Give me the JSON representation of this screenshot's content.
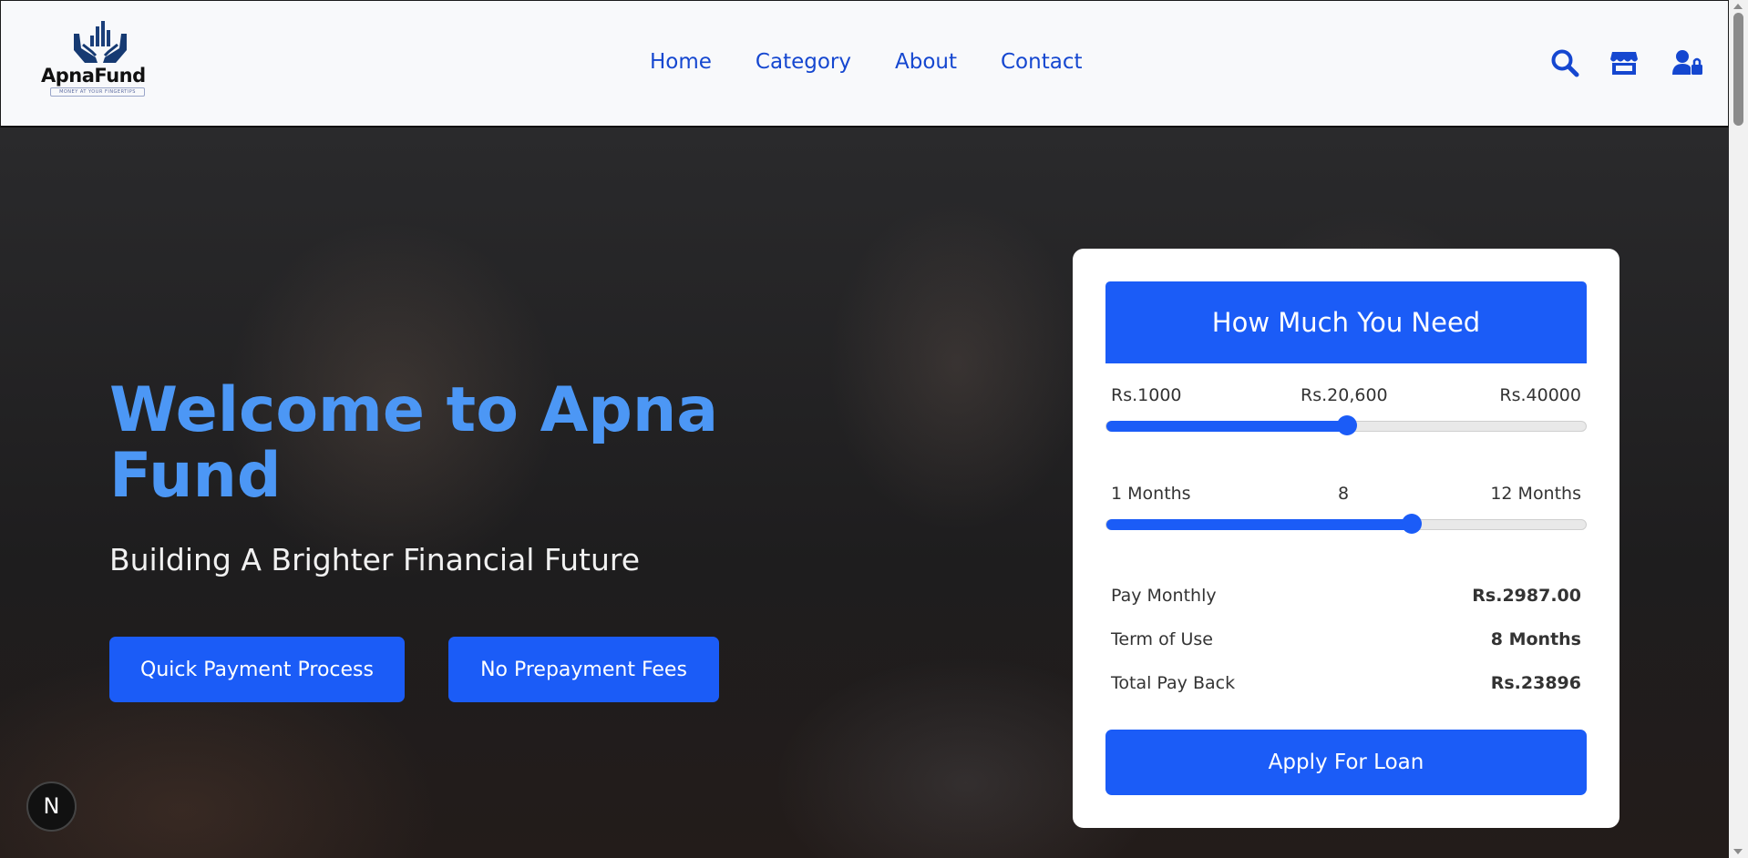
{
  "brand": {
    "name": "ApnaFund",
    "tagline": "MONEY AT YOUR FINGERTIPS",
    "icon": "hands-holding-coins-logo"
  },
  "nav": [
    {
      "label": "Home"
    },
    {
      "label": "Category"
    },
    {
      "label": "About"
    },
    {
      "label": "Contact"
    }
  ],
  "header_icons": [
    "search-icon",
    "store-icon",
    "user-lock-icon"
  ],
  "hero": {
    "title": "Welcome to Apna Fund",
    "subtitle": "Building A Brighter Financial Future",
    "buttons": [
      {
        "label": "Quick Payment Process"
      },
      {
        "label": "No Prepayment Fees"
      }
    ]
  },
  "calculator": {
    "title": "How Much You Need",
    "amount": {
      "min_label": "Rs.1000",
      "value_label": "Rs.20,600",
      "max_label": "Rs.40000",
      "min": 1000,
      "max": 40000,
      "value": 20600
    },
    "term": {
      "min_label": "1 Months",
      "value_label": "8",
      "max_label": "12 Months",
      "min": 1,
      "max": 12,
      "value": 8
    },
    "summary": [
      {
        "label": "Pay Monthly",
        "value": "Rs.2987.00"
      },
      {
        "label": "Term of Use",
        "value": "8 Months"
      },
      {
        "label": "Total Pay Back",
        "value": "Rs.23896"
      }
    ],
    "apply_label": "Apply For Loan"
  },
  "badge": {
    "label": "N"
  },
  "colors": {
    "accent": "#1b5cf7",
    "hero_title": "#4c97f5",
    "nav": "#1547d0"
  }
}
